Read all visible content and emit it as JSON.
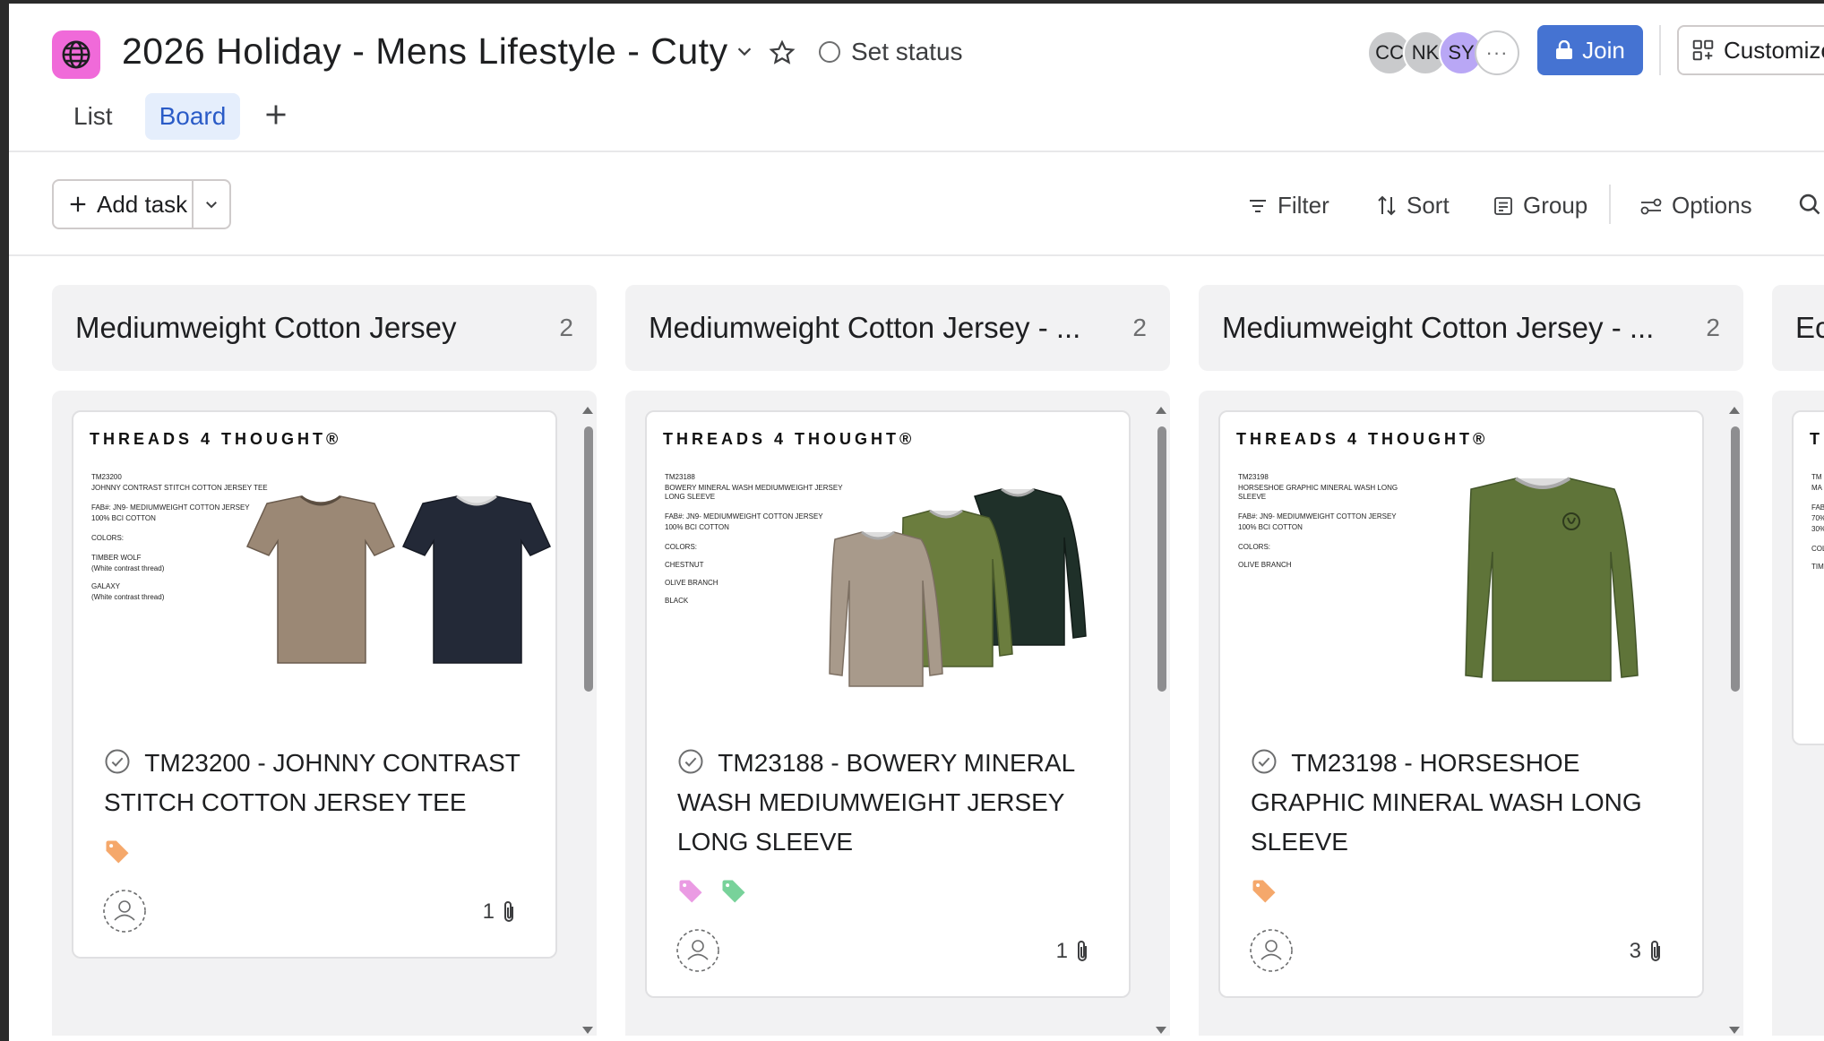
{
  "header": {
    "title": "2026 Holiday - Mens Lifestyle - Cuty",
    "status_label": "Set status",
    "avatars": [
      "CC",
      "NK",
      "SY"
    ],
    "more_label": "···",
    "join_label": "Join",
    "customize_label": "Customize",
    "icon_color": "#f06ad9",
    "join_color": "#4573d2"
  },
  "tabs": [
    {
      "label": "List",
      "active": false
    },
    {
      "label": "Board",
      "active": true
    }
  ],
  "toolbar": {
    "add_task_label": "Add task",
    "filter_label": "Filter",
    "sort_label": "Sort",
    "group_label": "Group",
    "options_label": "Options"
  },
  "columns": [
    {
      "title": "Mediumweight Cotton Jersey",
      "count": "2",
      "card": {
        "brand": "THREADS 4 THOUGHT®",
        "spec": [
          "TM23200",
          "JOHNNY CONTRAST STITCH COTTON JERSEY TEE",
          "FAB#: JN9- MEDIUMWEIGHT COTTON JERSEY",
          "100% BCI COTTON",
          "COLORS:",
          "TIMBER WOLF",
          "(White contrast thread)",
          "GALAXY",
          "(White contrast thread)"
        ],
        "title": "TM23200 - JOHNNY CONTRAST STITCH COTTON JERSEY TEE",
        "tags": [
          "#f5a86b"
        ],
        "attachments": "1"
      }
    },
    {
      "title": "Mediumweight Cotton Jersey - ...",
      "count": "2",
      "card": {
        "brand": "THREADS 4 THOUGHT®",
        "spec": [
          "TM23188",
          "BOWERY MINERAL WASH MEDIUMWEIGHT JERSEY LONG SLEEVE",
          "FAB#: JN9- MEDIUMWEIGHT COTTON JERSEY",
          "100% BCI COTTON",
          "COLORS:",
          "CHESTNUT",
          "OLIVE BRANCH",
          "BLACK"
        ],
        "title": "TM23188 - BOWERY MINERAL WASH MEDIUMWEIGHT JERSEY LONG SLEEVE",
        "tags": [
          "#ea9be3",
          "#78d29a"
        ],
        "attachments": "1"
      }
    },
    {
      "title": "Mediumweight Cotton Jersey - ...",
      "count": "2",
      "card": {
        "brand": "THREADS 4 THOUGHT®",
        "spec": [
          "TM23198",
          "HORSESHOE GRAPHIC MINERAL WASH LONG SLEEVE",
          "FAB#: JN9- MEDIUMWEIGHT COTTON JERSEY",
          "100% BCI COTTON",
          "COLORS:",
          "OLIVE BRANCH"
        ],
        "title": "TM23198 - HORSESHOE GRAPHIC MINERAL WASH LONG SLEEVE",
        "tags": [
          "#f5a86b"
        ],
        "attachments": "3"
      }
    },
    {
      "title": "Ec",
      "count": "",
      "card": {
        "brand": "TI",
        "spec": [
          "TM",
          "MA",
          "FAB",
          "70%",
          "30%",
          "COL",
          "TIME"
        ],
        "title": "",
        "tags": [],
        "attachments": ""
      }
    }
  ]
}
